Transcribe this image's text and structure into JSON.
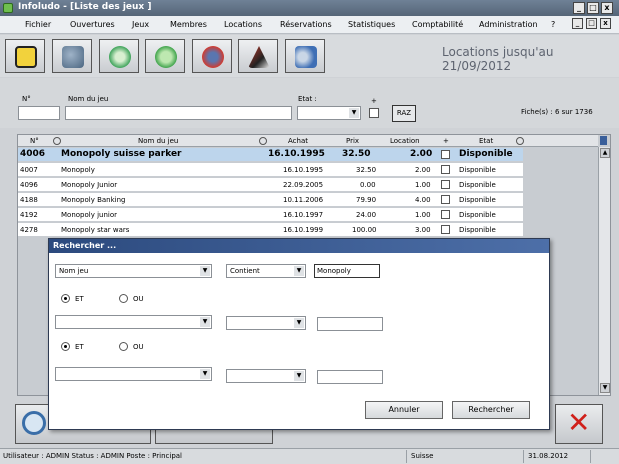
{
  "window": {
    "title": "Infoludo - [Liste des jeux ]"
  },
  "menu": [
    "Fichier",
    "Ouvertures",
    "Jeux",
    "Membres",
    "Locations",
    "Réservations",
    "Statistiques",
    "Comptabilité",
    "Administration",
    "?"
  ],
  "mdi_controls": [
    "_",
    "□",
    "x"
  ],
  "toolbar": {
    "buttons": [
      "dice-icon",
      "members-icon",
      "refresh-icon",
      "recycle-icon",
      "return-icon",
      "home-icon",
      "user-chat-icon"
    ],
    "locations_label": "Locations  jusqu'au 21/09/2012"
  },
  "filter": {
    "no_label": "N°",
    "name_label": "Nom du jeu",
    "etat_label": "Etat :",
    "plus_label": "+",
    "raz_label": "RAZ",
    "fiches": "Fiche(s) : 6 sur 1736"
  },
  "table": {
    "headers": [
      "N°",
      "Nom du jeu",
      "Achat",
      "Prix",
      "Location",
      "+",
      "Etat"
    ],
    "rows": [
      {
        "no": "4006",
        "nom": "Monopoly suisse parker",
        "achat": "16.10.1995",
        "prix": "32.50",
        "location": "2.00",
        "etat": "Disponible"
      },
      {
        "no": "4007",
        "nom": "Monopoly",
        "achat": "16.10.1995",
        "prix": "32.50",
        "location": "2.00",
        "etat": "Disponible"
      },
      {
        "no": "4096",
        "nom": "Monopoly Junior",
        "achat": "22.09.2005",
        "prix": "0.00",
        "location": "1.00",
        "etat": "Disponible"
      },
      {
        "no": "4188",
        "nom": "Monopoly  Banking",
        "achat": "10.11.2006",
        "prix": "79.90",
        "location": "4.00",
        "etat": "Disponible"
      },
      {
        "no": "4192",
        "nom": "Monopoly junior",
        "achat": "16.10.1997",
        "prix": "24.00",
        "location": "1.00",
        "etat": "Disponible"
      },
      {
        "no": "4278",
        "nom": "Monopoly star wars",
        "achat": "16.10.1999",
        "prix": "100.00",
        "location": "3.00",
        "etat": "Disponible"
      }
    ]
  },
  "dialog": {
    "title": "Rechercher ...",
    "field1": "Nom jeu",
    "op1": "Contient",
    "value1": "Monopoly",
    "et_label": "ET",
    "ou_label": "OU",
    "cancel_label": "Annuler",
    "search_label": "Rechercher"
  },
  "status": {
    "user": "Utilisateur : ADMIN Status : ADMIN Poste : Principal",
    "country": "Suisse",
    "date": "31.08.2012"
  }
}
